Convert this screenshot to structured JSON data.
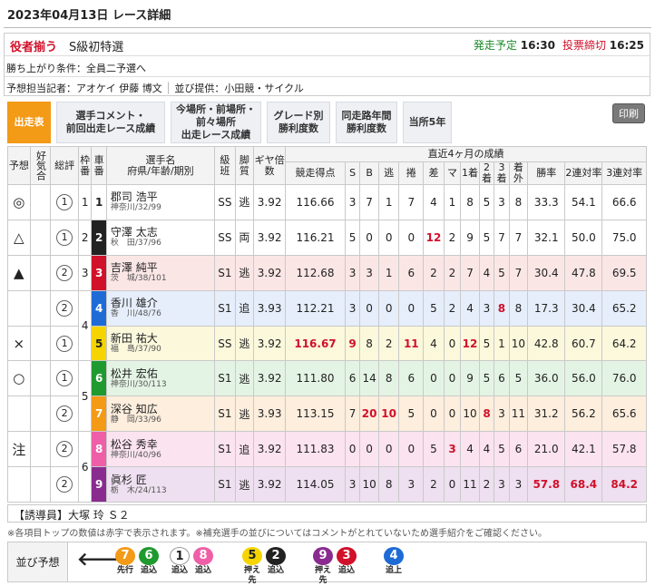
{
  "header": {
    "title": "2023年04月13日 レース詳細"
  },
  "race": {
    "name": "役者揃う",
    "cls": "S級初特選",
    "start_label": "発走予定",
    "start_time": "16:30",
    "close_label": "投票締切",
    "close_time": "16:25",
    "condition": "勝ち上がり条件：全員二予選へ",
    "staff": "予想担当記者：アオケイ 伊藤 博文",
    "provider": "並び提供：小田競・サイクル"
  },
  "tabs": [
    {
      "label": "出走表"
    },
    {
      "label": "選手コメント・\n前回出走レース成績"
    },
    {
      "label": "今場所・前場所・\n前々場所\n出走レース成績"
    },
    {
      "label": "グレード別\n勝利度数"
    },
    {
      "label": "同走路年間\n勝利度数"
    },
    {
      "label": "当所5年"
    }
  ],
  "print_label": "印刷",
  "table": {
    "h1": [
      "予想",
      "好気合",
      "総評",
      "枠番",
      "車番",
      "選手名\n府県/年齢/期別",
      "級班",
      "脚質",
      "ギヤ倍数",
      "直近4ヶ月の成績"
    ],
    "h2": [
      "競走得点",
      "S",
      "B",
      "逃",
      "捲",
      "差",
      "マ",
      "1着",
      "2着",
      "3着",
      "着外",
      "勝率",
      "2連対率",
      "3連対率"
    ],
    "rows": [
      {
        "pred": "◎",
        "sogo": "1",
        "car": "1",
        "color": "#ffffff",
        "name": "郡司 浩平",
        "info": "神奈川/32/99",
        "cls": "SS",
        "leg": "逃",
        "gear": "3.92",
        "score": "116.66",
        "s": "3",
        "b": "7",
        "nige": "1",
        "makuri": "7",
        "sashi": "4",
        "ma": "1",
        "c1": "8",
        "c2": "5",
        "c3": "3",
        "out": "8",
        "win": "33.3",
        "r2": "54.1",
        "r3": "66.6"
      },
      {
        "pred": "△",
        "sogo": "1",
        "car": "2",
        "color": "#222222",
        "name": "守澤 太志",
        "info": "秋　田/37/96",
        "cls": "SS",
        "leg": "両",
        "gear": "3.92",
        "score": "116.21",
        "s": "5",
        "b": "0",
        "nige": "0",
        "makuri": "0",
        "sashi": "12",
        "ma": "2",
        "c1": "9",
        "c2": "5",
        "c3": "7",
        "out": "7",
        "win": "32.1",
        "r2": "50.0",
        "r3": "75.0"
      },
      {
        "pred": "▲",
        "sogo": "2",
        "car": "3",
        "color": "#d1102a",
        "name": "吉澤 純平",
        "info": "茨　城/38/101",
        "cls": "S1",
        "leg": "逃",
        "gear": "3.92",
        "score": "112.68",
        "s": "3",
        "b": "3",
        "nige": "1",
        "makuri": "6",
        "sashi": "2",
        "ma": "2",
        "c1": "7",
        "c2": "4",
        "c3": "5",
        "out": "7",
        "win": "30.4",
        "r2": "47.8",
        "r3": "69.5"
      },
      {
        "pred": "",
        "sogo": "2",
        "car": "4",
        "color": "#1f6bd6",
        "name": "香川 雄介",
        "info": "香　川/48/76",
        "cls": "S1",
        "leg": "追",
        "gear": "3.93",
        "score": "112.21",
        "s": "3",
        "b": "0",
        "nige": "0",
        "makuri": "0",
        "sashi": "5",
        "ma": "2",
        "c1": "4",
        "c2": "3",
        "c3": "8",
        "out": "8",
        "win": "17.3",
        "r2": "30.4",
        "r3": "65.2"
      },
      {
        "pred": "×",
        "sogo": "1",
        "car": "5",
        "color": "#f5d400",
        "name": "新田 祐大",
        "info": "福　島/37/90",
        "cls": "SS",
        "leg": "逃",
        "gear": "3.92",
        "score": "116.67",
        "s": "9",
        "b": "8",
        "nige": "2",
        "makuri": "11",
        "sashi": "4",
        "ma": "0",
        "c1": "12",
        "c2": "5",
        "c3": "1",
        "out": "10",
        "win": "42.8",
        "r2": "60.7",
        "r3": "64.2"
      },
      {
        "pred": "○",
        "sogo": "1",
        "car": "6",
        "color": "#1f9a2e",
        "name": "松井 宏佑",
        "info": "神奈川/30/113",
        "cls": "S1",
        "leg": "逃",
        "gear": "3.92",
        "score": "111.80",
        "s": "6",
        "b": "14",
        "nige": "8",
        "makuri": "6",
        "sashi": "0",
        "ma": "0",
        "c1": "9",
        "c2": "5",
        "c3": "6",
        "out": "5",
        "win": "36.0",
        "r2": "56.0",
        "r3": "76.0"
      },
      {
        "pred": "",
        "sogo": "2",
        "car": "7",
        "color": "#f39a16",
        "name": "深谷 知広",
        "info": "静　岡/33/96",
        "cls": "S1",
        "leg": "逃",
        "gear": "3.93",
        "score": "113.15",
        "s": "7",
        "b": "20",
        "nige": "10",
        "makuri": "5",
        "sashi": "0",
        "ma": "0",
        "c1": "10",
        "c2": "8",
        "c3": "3",
        "out": "11",
        "win": "31.2",
        "r2": "56.2",
        "r3": "65.6"
      },
      {
        "pred": "注",
        "sogo": "2",
        "car": "8",
        "color": "#ef5fa7",
        "name": "松谷 秀幸",
        "info": "神奈川/40/96",
        "cls": "S1",
        "leg": "追",
        "gear": "3.92",
        "score": "111.83",
        "s": "0",
        "b": "0",
        "nige": "0",
        "makuri": "0",
        "sashi": "5",
        "ma": "3",
        "c1": "4",
        "c2": "4",
        "c3": "5",
        "out": "6",
        "win": "21.0",
        "r2": "42.1",
        "r3": "57.8"
      },
      {
        "pred": "",
        "sogo": "2",
        "car": "9",
        "color": "#8a2c8f",
        "name": "眞杉 匠",
        "info": "栃　木/24/113",
        "cls": "S1",
        "leg": "逃",
        "gear": "3.92",
        "score": "114.05",
        "s": "3",
        "b": "10",
        "nige": "8",
        "makuri": "3",
        "sashi": "2",
        "ma": "0",
        "c1": "11",
        "c2": "2",
        "c3": "3",
        "out": "3",
        "win": "57.8",
        "r2": "68.4",
        "r3": "84.2"
      }
    ],
    "waku": [
      "1",
      "2",
      "3",
      "4",
      "5",
      "6"
    ]
  },
  "guide": "【誘導員】大塚 玲 Ｓ２",
  "note": "※各項目トップの数値は赤字で表示されます。※補充選手の並びについてはコメントがとれていないため選手紹介をご確認ください。",
  "line": {
    "label": "並び予想",
    "chips": [
      {
        "n": "7",
        "t": "先行",
        "c": "#f39a16"
      },
      {
        "n": "6",
        "t": "追込",
        "c": "#1f9a2e"
      },
      {
        "n": "1",
        "t": "追込",
        "c": "#ffffff"
      },
      {
        "n": "8",
        "t": "追込",
        "c": "#ef5fa7"
      },
      {
        "n": "5",
        "t": "押え先",
        "c": "#f5d400"
      },
      {
        "n": "2",
        "t": "追込",
        "c": "#222222"
      },
      {
        "n": "9",
        "t": "押え先",
        "c": "#8a2c8f"
      },
      {
        "n": "3",
        "t": "追込",
        "c": "#d1102a"
      },
      {
        "n": "4",
        "t": "追上",
        "c": "#1f6bd6"
      }
    ]
  }
}
